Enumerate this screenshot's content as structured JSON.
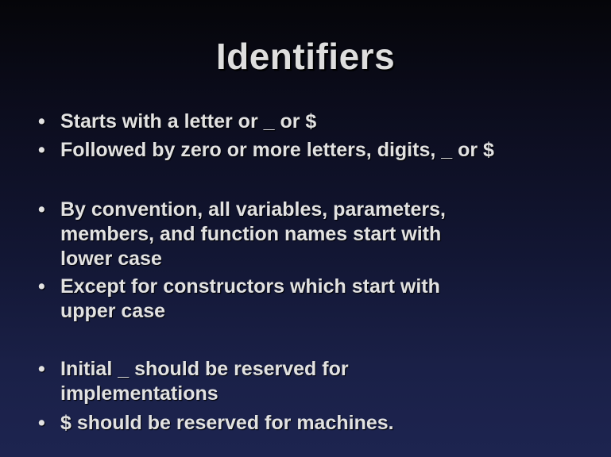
{
  "slide": {
    "title": "Identifiers",
    "bullet_symbol": "•",
    "bullets": [
      {
        "lines": [
          "Starts with a letter or _ or $"
        ]
      },
      {
        "lines": [
          "Followed by zero or more letters, digits, _ or $"
        ]
      },
      {
        "lines": [
          "By convention, all variables, parameters,",
          "members, and function names start with",
          "lower case"
        ]
      },
      {
        "lines": [
          "Except for constructors which start with",
          "upper case"
        ]
      },
      {
        "lines": [
          "Initial _ should be reserved for",
          "implementations"
        ]
      },
      {
        "lines": [
          "$ should be reserved for machines."
        ]
      }
    ]
  }
}
